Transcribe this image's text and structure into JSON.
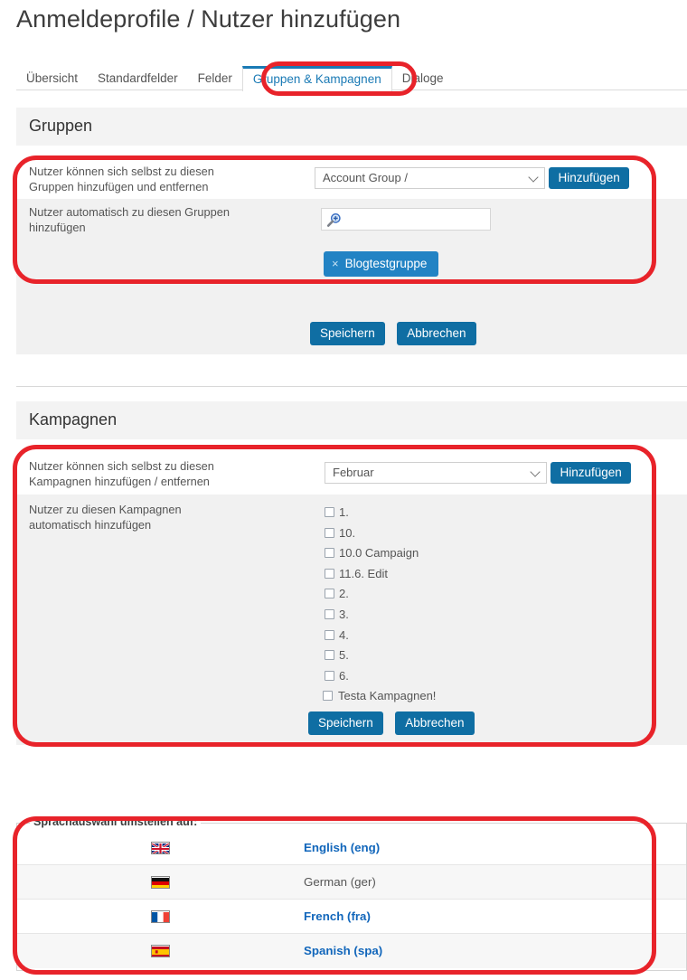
{
  "header": {
    "title": "Anmeldeprofile / Nutzer hinzufügen"
  },
  "tabs": [
    {
      "label": "Übersicht",
      "active": false
    },
    {
      "label": "Standardfelder",
      "active": false
    },
    {
      "label": "Felder",
      "active": false
    },
    {
      "label": "Gruppen & Kampagnen",
      "active": true
    },
    {
      "label": "Dialoge",
      "active": false
    }
  ],
  "groups_section": {
    "heading": "Gruppen",
    "row1": {
      "label_line1": "Nutzer können sich selbst zu diesen",
      "label_line2": "Gruppen hinzufügen und entfernen",
      "select_value": "Account Group /",
      "add_button": "Hinzufügen"
    },
    "row2": {
      "label_line1": "Nutzer automatisch zu diesen Gruppen",
      "label_line2": "hinzufügen",
      "search_value": "",
      "search_placeholder": "",
      "chip": {
        "label": "Blogtestgruppe",
        "remove": "×"
      }
    },
    "save_button": "Speichern",
    "cancel_button": "Abbrechen"
  },
  "campaigns_section": {
    "heading": "Kampagnen",
    "row1": {
      "label_line1": "Nutzer können sich selbst zu diesen",
      "label_line2": "Kampagnen hinzufügen / entfernen",
      "select_value": "Februar",
      "add_button": "Hinzufügen"
    },
    "row2": {
      "label_line1": "Nutzer zu diesen Kampagnen",
      "label_line2": "automatisch hinzufügen"
    },
    "checkboxes": [
      {
        "label": "1.",
        "checked": false
      },
      {
        "label": "10.",
        "checked": false
      },
      {
        "label": "10.0 Campaign",
        "checked": false
      },
      {
        "label": "11.6. Edit",
        "checked": false
      },
      {
        "label": "2.",
        "checked": false
      },
      {
        "label": "3.",
        "checked": false
      },
      {
        "label": "4.",
        "checked": false
      },
      {
        "label": "5.",
        "checked": false
      },
      {
        "label": "6.",
        "checked": false
      },
      {
        "label": "Testa Kampagnen!",
        "checked": false
      }
    ],
    "save_button": "Speichern",
    "cancel_button": "Abbrechen"
  },
  "language_section": {
    "legend": "Sprachauswahl umstellen auf:",
    "rows": [
      {
        "name": "English (eng)",
        "flag": "flag-uk-icon",
        "is_link": true
      },
      {
        "name": "German (ger)",
        "flag": "flag-germany-icon",
        "is_link": false
      },
      {
        "name": "French (fra)",
        "flag": "flag-france-icon",
        "is_link": true
      },
      {
        "name": "Spanish (spa)",
        "flag": "flag-spain-icon",
        "is_link": true
      }
    ]
  },
  "colors": {
    "accent_blue": "#0f6ea3",
    "link_blue": "#1166bb",
    "tab_active": "#1a7ab5",
    "chip_blue": "#2283c4",
    "annotation_red": "#e8232a",
    "section_header_bg": "#f3f3f3"
  }
}
